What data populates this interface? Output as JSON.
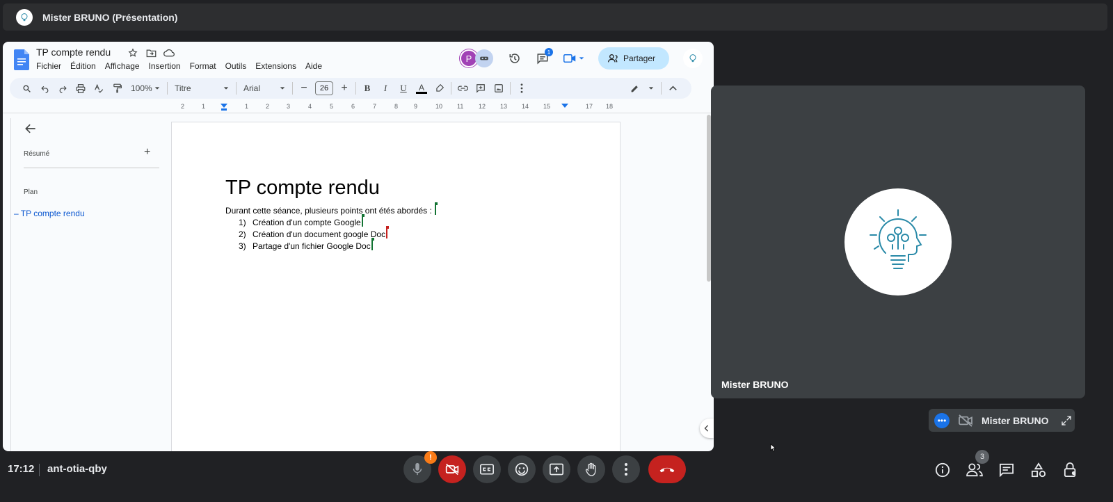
{
  "presentation_bar": {
    "title": "Mister BRUNO (Présentation)"
  },
  "docs": {
    "title": "TP compte rendu",
    "menu": [
      "Fichier",
      "Édition",
      "Affichage",
      "Insertion",
      "Format",
      "Outils",
      "Extensions",
      "Aide"
    ],
    "user_initial": "P",
    "comments_count": "1",
    "share_label": "Partager",
    "toolbar": {
      "zoom": "100%",
      "style": "Titre",
      "font": "Arial",
      "font_size": "26",
      "bold": "B",
      "italic": "I",
      "underline": "U",
      "text_color_glyph": "A"
    },
    "ruler_ticks": [
      "2",
      "1",
      "1",
      "2",
      "3",
      "4",
      "5",
      "6",
      "7",
      "8",
      "9",
      "10",
      "11",
      "12",
      "13",
      "14",
      "15",
      "16",
      "17",
      "18"
    ],
    "outline": {
      "summary_label": "Résumé",
      "plan_label": "Plan",
      "items": [
        "TP compte rendu"
      ]
    },
    "page": {
      "heading": "TP compte rendu",
      "intro": "Durant cette séance, plusieurs points ont étés abordés :",
      "list": [
        {
          "num": "1)",
          "text": "Création d'un compte Google"
        },
        {
          "num": "2)",
          "text": "Création d'un document google Doc"
        },
        {
          "num": "3)",
          "text": "Partage d'un fichier Google Doc"
        }
      ]
    }
  },
  "participant": {
    "name": "Mister BRUNO"
  },
  "self_view": {
    "name": "Mister BRUNO"
  },
  "meeting": {
    "time": "17:12",
    "code": "ant-otia-qby",
    "participants_count": "3",
    "mic_warning": "!"
  },
  "colors": {
    "accent": "#1a73e8",
    "danger": "#c5221f",
    "bg": "#202124",
    "tile": "#3c4043",
    "share": "#c2e7ff"
  }
}
